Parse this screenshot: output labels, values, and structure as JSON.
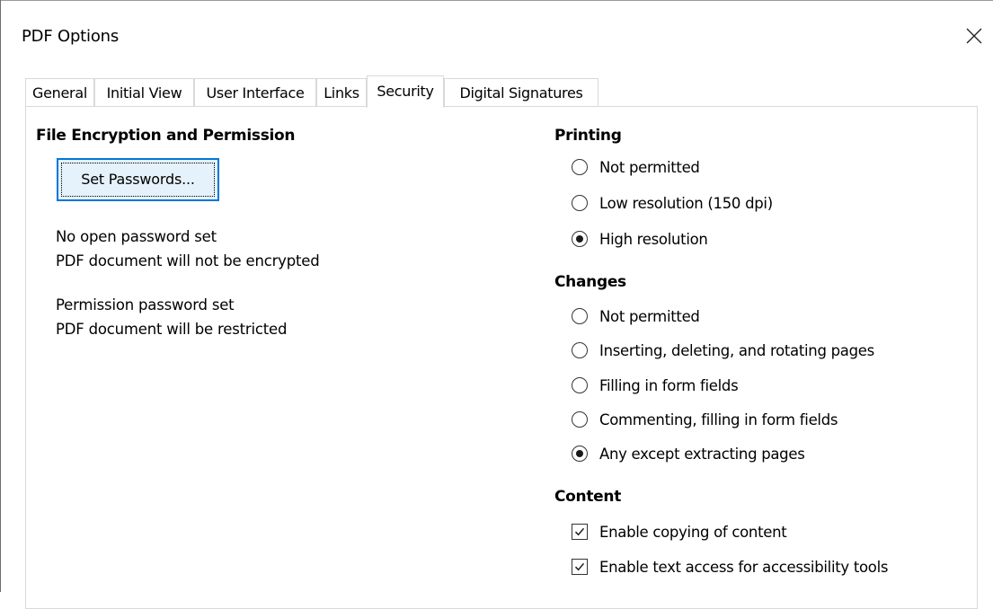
{
  "dialog": {
    "title": "PDF Options"
  },
  "tabs": [
    {
      "label": "General"
    },
    {
      "label": "Initial View"
    },
    {
      "label": "User Interface"
    },
    {
      "label": "Links"
    },
    {
      "label": "Security",
      "active": true
    },
    {
      "label": "Digital Signatures"
    }
  ],
  "encryption": {
    "heading": "File Encryption and Permission",
    "set_passwords_label": "Set Passwords...",
    "open_status_line1": "No open password set",
    "open_status_line2": "PDF document will not be encrypted",
    "permission_status_line1": "Permission password set",
    "permission_status_line2": "PDF document will be restricted"
  },
  "printing": {
    "heading": "Printing",
    "options": [
      {
        "label": "Not permitted",
        "selected": false
      },
      {
        "label": "Low resolution (150 dpi)",
        "selected": false
      },
      {
        "label": "High resolution",
        "selected": true
      }
    ]
  },
  "changes": {
    "heading": "Changes",
    "options": [
      {
        "label": "Not permitted",
        "selected": false
      },
      {
        "label": "Inserting, deleting, and rotating pages",
        "selected": false
      },
      {
        "label": "Filling in form fields",
        "selected": false
      },
      {
        "label": "Commenting, filling in form fields",
        "selected": false
      },
      {
        "label": "Any except extracting pages",
        "selected": true
      }
    ]
  },
  "content": {
    "heading": "Content",
    "options": [
      {
        "label": "Enable copying of content",
        "checked": true
      },
      {
        "label": "Enable text access for accessibility tools",
        "checked": true
      }
    ]
  },
  "icons": {
    "close": "close-icon",
    "radio": "radio-button",
    "checkbox": "checkbox-checkmark-icon"
  },
  "colors": {
    "focus_border": "#0078d7",
    "button_bg": "#e5f1fb",
    "tab_border": "#d9d9d9"
  }
}
